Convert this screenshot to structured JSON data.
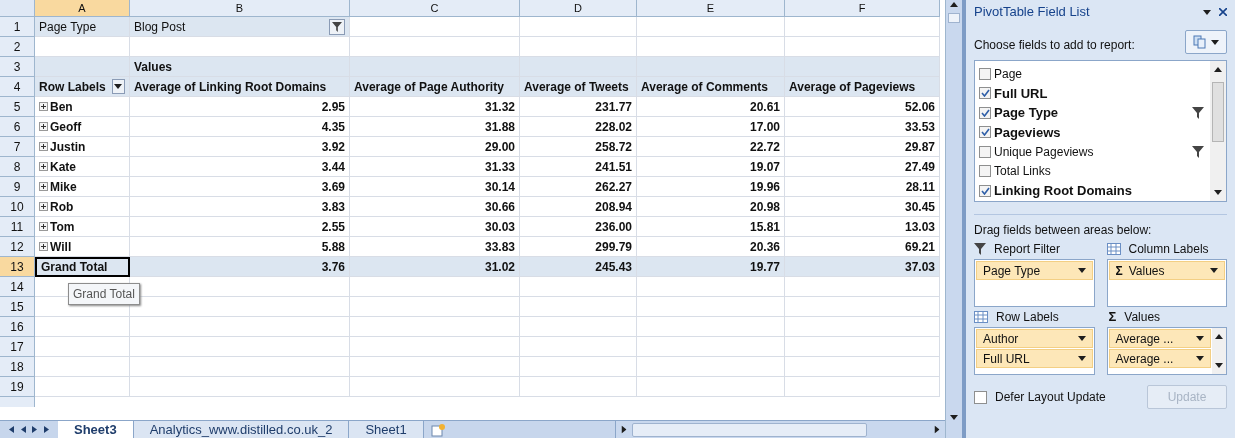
{
  "columns": [
    {
      "label": "A",
      "selected": true
    },
    {
      "label": "B",
      "selected": false
    },
    {
      "label": "C",
      "selected": false
    },
    {
      "label": "D",
      "selected": false
    },
    {
      "label": "E",
      "selected": false
    },
    {
      "label": "F",
      "selected": false
    }
  ],
  "rows": [
    {
      "number": "1",
      "kind": "filter",
      "selected": false,
      "cells": [
        "Page Type",
        "Blog Post"
      ]
    },
    {
      "number": "2",
      "kind": "blank",
      "selected": false,
      "cells": []
    },
    {
      "number": "3",
      "kind": "header",
      "selected": false,
      "cells": [
        "",
        "Values",
        "",
        "",
        "",
        ""
      ]
    },
    {
      "number": "4",
      "kind": "header",
      "selected": false,
      "cells": [
        "Row Labels",
        "Average of Linking Root Domains",
        "Average of Page Authority",
        "Average of Tweets",
        "Average of Comments",
        "Average of Pageviews"
      ]
    },
    {
      "number": "5",
      "kind": "item",
      "selected": false,
      "expanded": false,
      "cells": [
        "Ben",
        "2.95",
        "31.32",
        "231.77",
        "20.61",
        "52.06"
      ]
    },
    {
      "number": "6",
      "kind": "item",
      "selected": false,
      "expanded": false,
      "cells": [
        "Geoff",
        "4.35",
        "31.88",
        "228.02",
        "17.00",
        "33.53"
      ]
    },
    {
      "number": "7",
      "kind": "item",
      "selected": false,
      "expanded": false,
      "cells": [
        "Justin",
        "3.92",
        "29.00",
        "258.72",
        "22.72",
        "29.87"
      ]
    },
    {
      "number": "8",
      "kind": "item",
      "selected": false,
      "expanded": false,
      "cells": [
        "Kate",
        "3.44",
        "31.33",
        "241.51",
        "19.07",
        "27.49"
      ]
    },
    {
      "number": "9",
      "kind": "item",
      "selected": false,
      "expanded": false,
      "cells": [
        "Mike",
        "3.69",
        "30.14",
        "262.27",
        "19.96",
        "28.11"
      ]
    },
    {
      "number": "10",
      "kind": "item",
      "selected": false,
      "expanded": false,
      "cells": [
        "Rob",
        "3.83",
        "30.66",
        "208.94",
        "20.98",
        "30.45"
      ]
    },
    {
      "number": "11",
      "kind": "item",
      "selected": false,
      "expanded": false,
      "cells": [
        "Tom",
        "2.55",
        "30.03",
        "236.00",
        "15.81",
        "13.03"
      ]
    },
    {
      "number": "12",
      "kind": "item",
      "selected": false,
      "expanded": false,
      "cells": [
        "Will",
        "5.88",
        "33.83",
        "299.79",
        "20.36",
        "69.21"
      ]
    },
    {
      "number": "13",
      "kind": "total",
      "selected": true,
      "cells": [
        "Grand Total",
        "3.76",
        "31.02",
        "245.43",
        "19.77",
        "37.03"
      ]
    },
    {
      "number": "14",
      "kind": "blank",
      "selected": false,
      "cells": []
    },
    {
      "number": "15",
      "kind": "blank",
      "selected": false,
      "cells": []
    },
    {
      "number": "16",
      "kind": "blank",
      "selected": false,
      "cells": []
    },
    {
      "number": "17",
      "kind": "blank",
      "selected": false,
      "cells": []
    },
    {
      "number": "18",
      "kind": "blank",
      "selected": false,
      "cells": []
    },
    {
      "number": "19",
      "kind": "blank",
      "selected": false,
      "cells": []
    }
  ],
  "tooltip": {
    "text": "Grand Total"
  },
  "sheet_tabs": [
    {
      "label": "Sheet3",
      "selected": true
    },
    {
      "label": "Analytics_www.distilled.co.uk_2",
      "selected": false
    },
    {
      "label": "Sheet1",
      "selected": false
    }
  ],
  "field_list": {
    "title": "PivotTable Field List",
    "prompt": "Choose fields to add to report:",
    "fields": [
      {
        "label": "Page",
        "checked": false,
        "filtered": false
      },
      {
        "label": "Full URL",
        "checked": true,
        "filtered": false
      },
      {
        "label": "Page Type",
        "checked": true,
        "filtered": true
      },
      {
        "label": "Pageviews",
        "checked": true,
        "filtered": false
      },
      {
        "label": "Unique Pageviews",
        "checked": false,
        "filtered": true
      },
      {
        "label": "Total Links",
        "checked": false,
        "filtered": false
      },
      {
        "label": "Linking Root Domains",
        "checked": true,
        "filtered": false
      }
    ],
    "drag_prompt": "Drag fields between areas below:",
    "areas": [
      {
        "kind": "filter",
        "title": "Report Filter",
        "items": [
          {
            "label": "Page Type"
          }
        ]
      },
      {
        "kind": "columns",
        "title": "Column Labels",
        "items": [
          {
            "symbol": "Σ",
            "label": "Values"
          }
        ]
      },
      {
        "kind": "rows",
        "title": "Row Labels",
        "items": [
          {
            "label": "Author"
          },
          {
            "label": "Full URL"
          }
        ]
      },
      {
        "kind": "values",
        "symbol": "Σ",
        "title": "Values",
        "items": [
          {
            "label": "Average ..."
          },
          {
            "label": "Average ..."
          }
        ]
      }
    ],
    "defer": {
      "label": "Defer Layout Update",
      "checked": false
    },
    "update_button": {
      "label": "Update",
      "disabled": true
    }
  }
}
